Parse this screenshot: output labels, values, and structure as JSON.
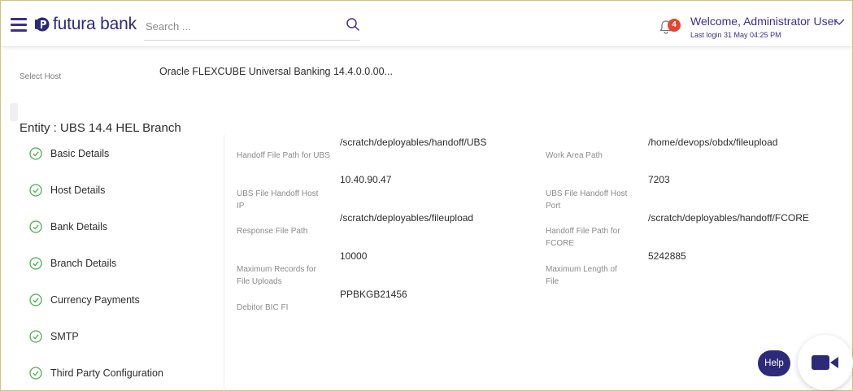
{
  "header": {
    "logo_text": "futura bank",
    "search_placeholder": "Search ...",
    "notification_count": "4",
    "welcome_text": "Welcome, Administrator User",
    "last_login": "Last login 31 May 04:25 PM"
  },
  "host": {
    "label": "Select Host",
    "value": "Oracle FLEXCUBE Universal Banking 14.4.0.0.00..."
  },
  "entity": "Entity : UBS 14.4 HEL Branch",
  "steps": [
    {
      "label": "Basic Details",
      "status": "complete"
    },
    {
      "label": "Host Details",
      "status": "complete"
    },
    {
      "label": "Bank Details",
      "status": "complete"
    },
    {
      "label": "Branch Details",
      "status": "complete"
    },
    {
      "label": "Currency Payments",
      "status": "complete"
    },
    {
      "label": "SMTP",
      "status": "complete"
    },
    {
      "label": "Third Party Configuration",
      "status": "complete"
    }
  ],
  "fields": {
    "handoff_ubs": {
      "label": "Handoff File Path for UBS",
      "value": "/scratch/deployables/handoff/UBS"
    },
    "work_area": {
      "label": "Work Area Path",
      "value": "/home/devops/obdx/fileupload"
    },
    "ubs_host_ip": {
      "label": "UBS File Handoff Host IP",
      "value": "10.40.90.47"
    },
    "ubs_host_port": {
      "label": "UBS File Handoff Host Port",
      "value": "7203"
    },
    "response_path": {
      "label": "Response File Path",
      "value": "/scratch/deployables/fileupload"
    },
    "handoff_fcore": {
      "label": "Handoff File Path for FCORE",
      "value": "/scratch/deployables/handoff/FCORE"
    },
    "max_records": {
      "label": "Maximum Records for File Uploads",
      "value": "10000"
    },
    "max_length": {
      "label": "Maximum Length of File",
      "value": "5242885"
    },
    "debitor_bic": {
      "label": "Debitor BIC FI",
      "value": "PPBKGB21456"
    }
  },
  "help_label": "Help",
  "colors": {
    "brand": "#2d2a7a",
    "accent": "#3b2f8f",
    "success": "#4caf50",
    "badge": "#e5452f"
  },
  "icons": {
    "menu": "hamburger-icon",
    "search": "search-icon",
    "notification": "bell-icon",
    "step_complete": "check-circle-icon",
    "video": "video-camera-icon"
  }
}
